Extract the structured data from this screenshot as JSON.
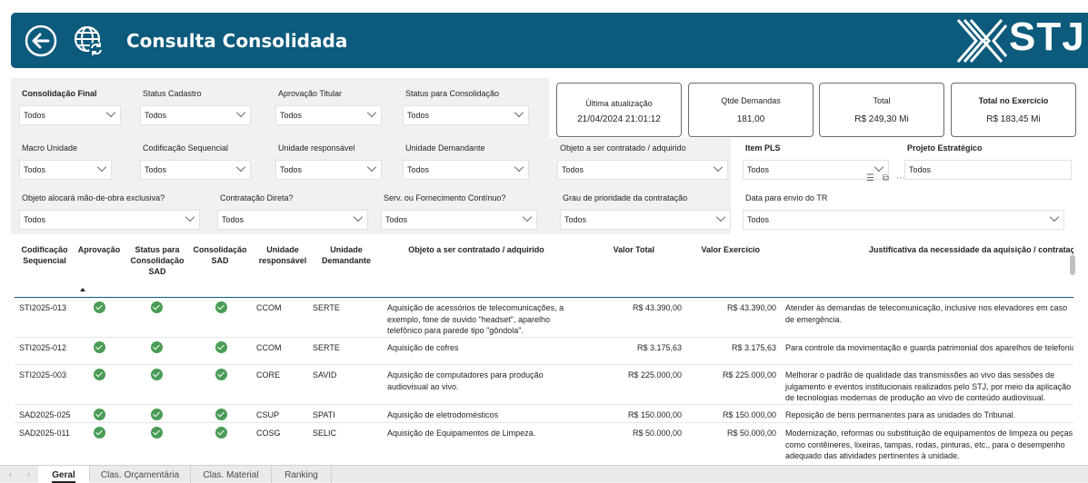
{
  "header": {
    "title": "Consulta Consolidada",
    "logo_text": "STJ"
  },
  "filters": {
    "row1": [
      {
        "label": "Consolidação Final",
        "value": "Todos"
      },
      {
        "label": "Status Cadastro",
        "value": "Todos"
      },
      {
        "label": "Aprovação Titular",
        "value": "Todos"
      },
      {
        "label": "Status para Consolidação",
        "value": "Todos"
      }
    ],
    "row2": [
      {
        "label": "Macro Unidade",
        "value": "Todos"
      },
      {
        "label": "Codificação Sequencial",
        "value": "Todos"
      },
      {
        "label": "Unidade responsável",
        "value": "Todos"
      },
      {
        "label": "Unidade Demandante",
        "value": "Todos"
      },
      {
        "label": "Objeto a ser contratado / adquirido",
        "value": "Todos"
      },
      {
        "label": "Item PLS",
        "value": "Todos"
      },
      {
        "label": "Projeto Estratégico",
        "value": "Todos"
      }
    ],
    "row3": [
      {
        "label": "Objeto alocará mão-de-obra exclusiva?",
        "value": "Todos"
      },
      {
        "label": "Contratação Direta?",
        "value": "Todos"
      },
      {
        "label": "Serv. ou Fornecimento Contínuo?",
        "value": "Todos"
      },
      {
        "label": "Grau de prioridade da contratação",
        "value": "Todos"
      },
      {
        "label": "Data para envio do TR",
        "value": "Todos"
      }
    ]
  },
  "cards": [
    {
      "title": "Última atualização",
      "value": "21/04/2024 21:01:12"
    },
    {
      "title": "Qtde Demandas",
      "value": "181,00"
    },
    {
      "title": "Total",
      "value": "R$ 249,30 Mi"
    },
    {
      "title": "Total no Exercício",
      "value": "R$ 183,45 Mi"
    }
  ],
  "table": {
    "headers": [
      "Codificação Sequencial",
      "Aprovação",
      "Status para Consolidação SAD",
      "Consolidação SAD",
      "Unidade responsável",
      "Unidade Demandante",
      "Objeto a ser contratado / adquirido",
      "Valor Total",
      "Valor Exercício",
      "Justificativa da necessidade da aquisição / contratação"
    ],
    "rows": [
      {
        "cod": "STI2025-013",
        "ur": "CCOM",
        "ud": "SERTE",
        "obj": "Aquisição de acessórios de telecomunicações, a exemplo, fone de ouvido \"headset\", aparelho telefônico para parede tipo \"gôndola\".",
        "vt": "R$ 43.390,00",
        "ve": "R$ 43.390,00",
        "just": "Atender às demandas de telecomunicação, inclusive nos elevadores em caso de emergência."
      },
      {
        "cod": "STI2025-012",
        "ur": "CCOM",
        "ud": "SERTE",
        "obj": "Aquisição de cofres",
        "vt": "R$ 3.175,63",
        "ve": "R$ 3.175,63",
        "just": "Para controle da movimentação e guarda patrimonial dos aparelhos de telefonia"
      },
      {
        "cod": "STI2025-003",
        "ur": "CORE",
        "ud": "SAVID",
        "obj": "Aquisição de computadores para produção audiovisual ao vivo.",
        "vt": "R$ 225.000,00",
        "ve": "R$ 225.000,00",
        "just": "Melhorar o padrão de qualidade das transmissões ao vivo das sessões de julgamento e eventos institucionais realizados pelo STJ, por meio da aplicação de tecnologias modernas de produção ao vivo de conteúdo audiovisual."
      },
      {
        "cod": "SAD2025-025",
        "ur": "CSUP",
        "ud": "SPATI",
        "obj": "Aquisição de eletrodomésticos",
        "vt": "R$ 150.000,00",
        "ve": "R$ 150.000,00",
        "just": "Reposição de bens permanentes para as unidades do Tribunal."
      },
      {
        "cod": "SAD2025-011",
        "ur": "COSG",
        "ud": "SELIC",
        "obj": "Aquisição de Equipamentos de Limpeza.",
        "vt": "R$ 50.000,00",
        "ve": "R$ 50.000,00",
        "just": "Modernização, reformas ou substituição de equipamentos de limpeza ou peças, como contêineres, lixeiras, tampas, rodas, pinturas, etc., para o desempenho adequado das atividades pertinentes à unidade."
      }
    ]
  },
  "tabs": [
    "Geral",
    "Clas. Orçamentária",
    "Clas. Material",
    "Ranking"
  ]
}
